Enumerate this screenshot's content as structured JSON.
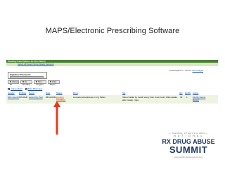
{
  "slide": {
    "title": "MAPS/Electronic Prescribing Software"
  },
  "ui": {
    "header": "Pending Prescriptions for this Patient",
    "select_links": "Select All  Select None  Delete Selected",
    "rx_range_prefix": "Prescriptions 1 - 20 of 1",
    "rx_range_link": "Print Pages",
    "signature_label": "Signature Password:",
    "buttons": [
      {
        "label": "Allowed Rx"
      },
      {
        "label": "Rx Encoding"
      },
      {
        "label": "Print Unsigned"
      },
      {
        "label": "Order Report"
      }
    ],
    "links": {
      "add": "Add to Meds",
      "print": "Print Pharmacy"
    },
    "columns": {
      "sender": "Sender",
      "drug_date": "Dr/Date",
      "name": "Name",
      "date": "Date",
      "status": "Status",
      "drug": "Drug",
      "sig": "Sig",
      "qty": "Qty",
      "refills": "Refills",
      "action": "Action"
    },
    "row": {
      "sender": "DDx-Nevich",
      "drug_date": "WS Multi",
      "name": "Hello Kitty Test",
      "date": "06/14/2012",
      "status_line1": "pending",
      "status_line2": "(modified)",
      "drug": "Lunesta (eszopiclone) 1 mg Tablet",
      "sig_line1": "Take 2 tablet by mouth every hour to as hours while awake",
      "sig_line2": "after meals - tigre",
      "qty": "30",
      "refills": "1",
      "action_line1": "Modify Delete",
      "action_line2": "Report"
    },
    "colors": {
      "header_green": "#4a7f34",
      "bar_light_green": "#d9e7c0",
      "row_bg": "#eef4e2",
      "link_blue": "#1a4ab0",
      "arrow_red": "#e53b1e"
    }
  },
  "logo": {
    "dates": "— Stamford, CT April 2-4, 2013 —",
    "national": "N A T I O N A L",
    "rx_drug": "RX DRUG ABUSE",
    "summit": "SUMMIT",
    "url": "www.nationalrxdrugabusesummit.org"
  }
}
